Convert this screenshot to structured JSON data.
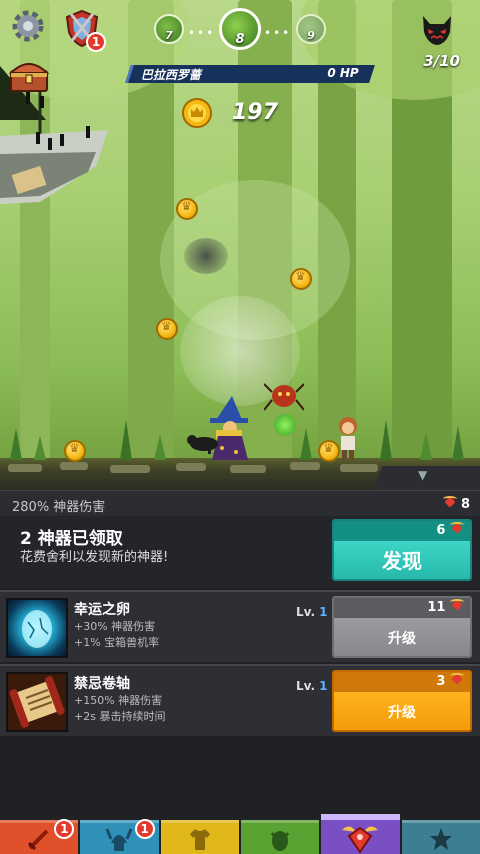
{
  "hud": {
    "stages": {
      "prev": "7",
      "current": "8",
      "next": "9"
    },
    "shield_badge": "1",
    "wave": "3/10",
    "enemy_name": "巴拉西罗蔷",
    "enemy_hp": "0 HP",
    "gold": "197"
  },
  "icons": {
    "settings": "gear-icon",
    "shield": "shield-icon",
    "chest": "treasure-chest-icon",
    "boss": "demon-face-icon",
    "coin": "crown-coin-icon",
    "relic": "winged-relic-icon"
  },
  "artifacts": {
    "damage_stat": "280% 神器伤害",
    "relics": "8",
    "discover": {
      "title": "2 神器已领取",
      "subtitle": "花费舍利以发现新的神器!",
      "cost": "6",
      "button": "发现"
    },
    "items": [
      {
        "name": "幸运之卵",
        "effect1": "+30% 神器伤害",
        "effect2": "+1% 宝箱兽机率",
        "lv_label": "Lv.",
        "lv_value": "1",
        "cost": "11",
        "button": "升级"
      },
      {
        "name": "禁忌卷轴",
        "effect1": "+150% 神器伤害",
        "effect2": "+2s 暴击持续时间",
        "lv_label": "Lv.",
        "lv_value": "1",
        "cost": "3",
        "button": "升级"
      }
    ]
  },
  "nav": {
    "heroes_badge": "1",
    "clan_badge": "1",
    "tabs": [
      "heroes",
      "clan",
      "equipment",
      "pets",
      "artifacts",
      "shop"
    ],
    "active": "artifacts"
  },
  "colors": {
    "discover_teal": "#24b8a9",
    "upgrade_orange": "#f29a0a",
    "upgrade_gray": "#848689",
    "level_blue": "#59b3ff",
    "forest_green": "#a8cf72"
  }
}
